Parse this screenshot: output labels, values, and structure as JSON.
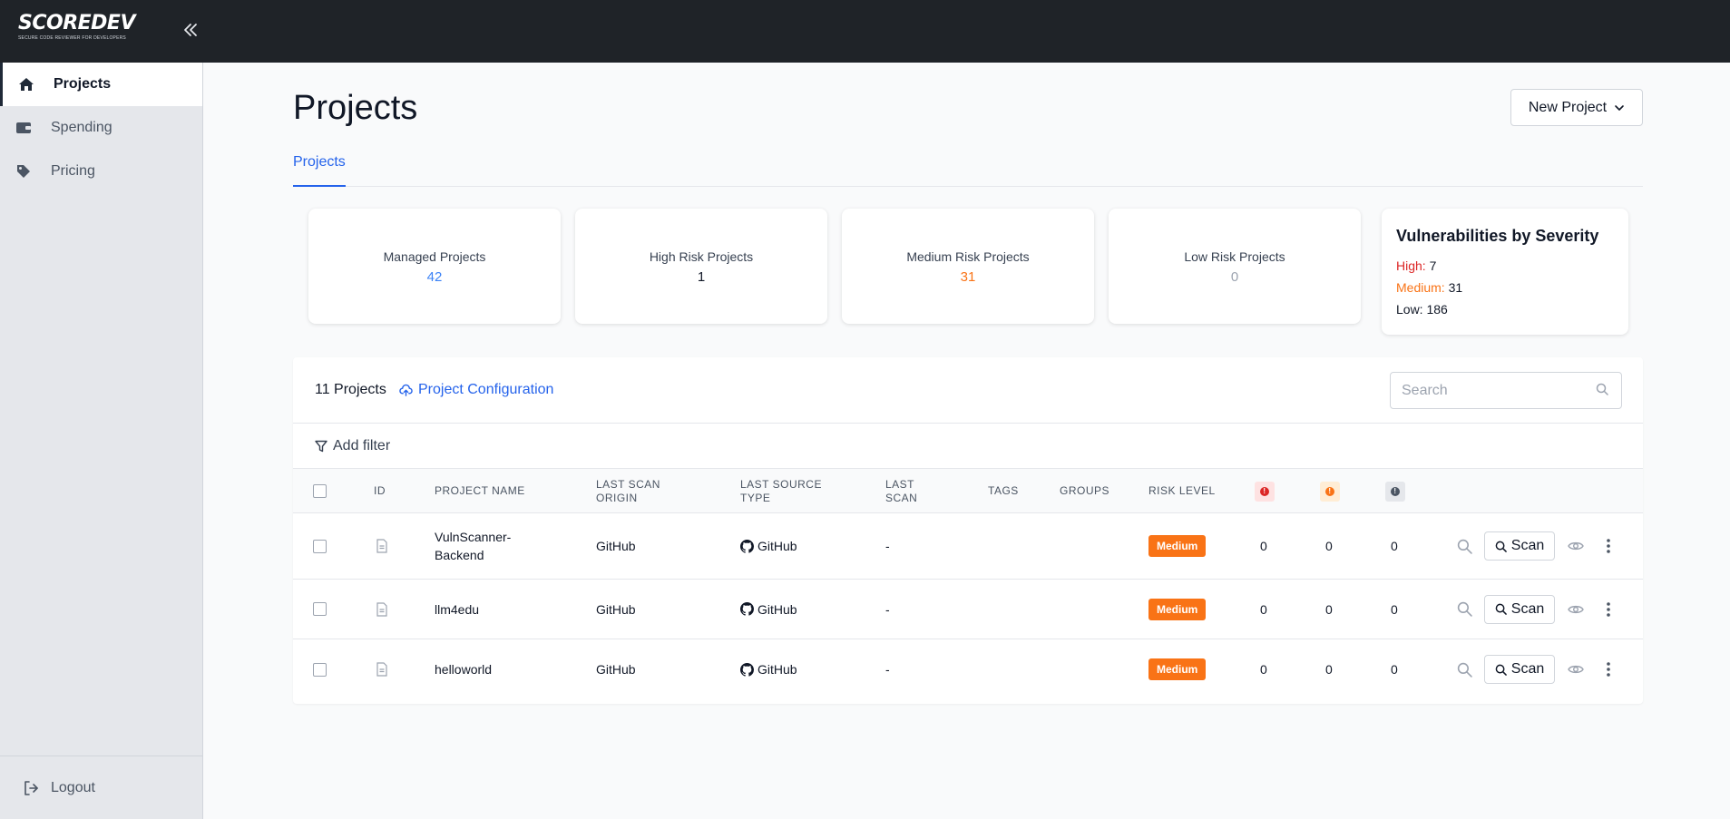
{
  "brand": {
    "name": "SCOREDEV",
    "tagline": "SECURE CODE REVIEWER FOR DEVELOPERS"
  },
  "sidebar": {
    "items": [
      {
        "label": "Projects",
        "icon": "home-icon",
        "active": true
      },
      {
        "label": "Spending",
        "icon": "wallet-icon",
        "active": false
      },
      {
        "label": "Pricing",
        "icon": "tag-icon",
        "active": false
      }
    ],
    "logout": "Logout"
  },
  "page": {
    "title": "Projects",
    "new_project": "New Project",
    "tab": "Projects"
  },
  "stats": [
    {
      "label": "Managed Projects",
      "value": "42",
      "color": "#3b82f6"
    },
    {
      "label": "High Risk Projects",
      "value": "1",
      "color": "#111827"
    },
    {
      "label": "Medium Risk Projects",
      "value": "31",
      "color": "#f97316"
    },
    {
      "label": "Low Risk Projects",
      "value": "0",
      "color": "#9ca3af"
    }
  ],
  "severity": {
    "title": "Vulnerabilities by Severity",
    "high_label": "High:",
    "high_value": "7",
    "medium_label": "Medium:",
    "medium_value": "31",
    "low_label": "Low:",
    "low_value": "186"
  },
  "table": {
    "count": "11 Projects",
    "config": "Project Configuration",
    "search_placeholder": "Search",
    "add_filter": "Add filter",
    "headers": {
      "id": "ID",
      "name": "PROJECT NAME",
      "origin": "LAST SCAN ORIGIN",
      "source_type": "LAST SOURCE TYPE",
      "last_scan": "LAST SCAN",
      "tags": "TAGS",
      "groups": "GROUPS",
      "risk": "RISK LEVEL"
    },
    "rows": [
      {
        "name": "VulnScanner-Backend",
        "origin": "GitHub",
        "source": "GitHub",
        "last_scan": "-",
        "risk": "Medium",
        "high": "0",
        "medium": "0",
        "low": "0",
        "scan": "Scan"
      },
      {
        "name": "llm4edu",
        "origin": "GitHub",
        "source": "GitHub",
        "last_scan": "-",
        "risk": "Medium",
        "high": "0",
        "medium": "0",
        "low": "0",
        "scan": "Scan"
      },
      {
        "name": "helloworld",
        "origin": "GitHub",
        "source": "GitHub",
        "last_scan": "-",
        "risk": "Medium",
        "high": "0",
        "medium": "0",
        "low": "0",
        "scan": "Scan"
      }
    ]
  },
  "colors": {
    "accent": "#2563eb",
    "high": "#dc2626",
    "medium": "#f97316",
    "topbar": "#1f2328"
  }
}
